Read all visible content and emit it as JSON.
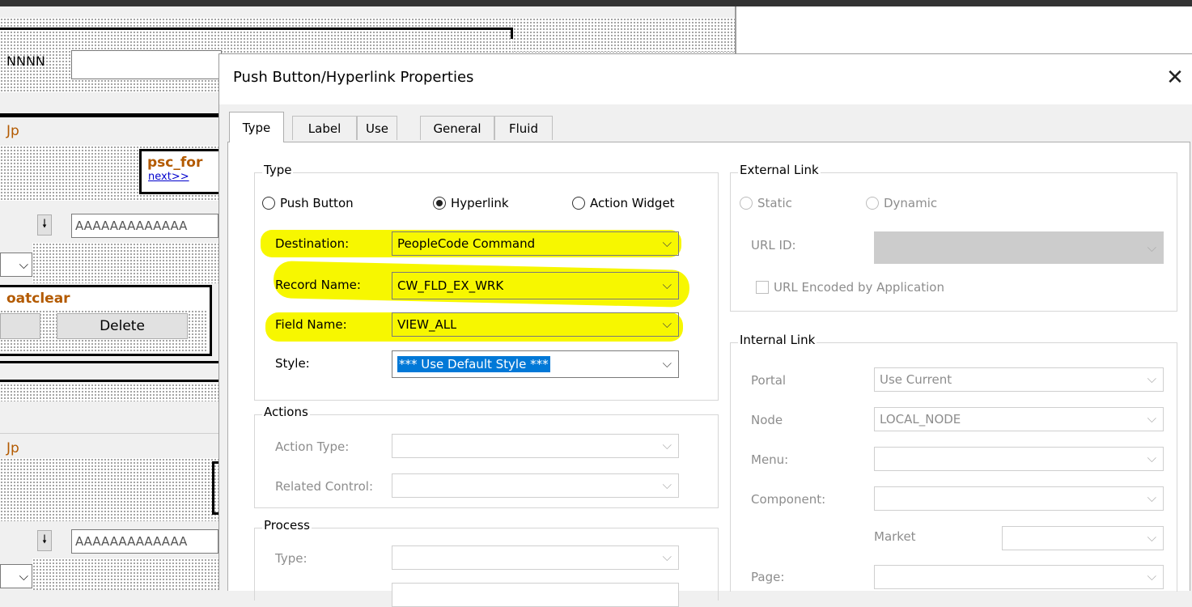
{
  "background": {
    "tab_label_partial": "NNNN",
    "section_label_1": "Jp",
    "section_label_2": "Jp",
    "psc_label": "psc_for",
    "next_link": "next>>",
    "field_placeholder_1": "AAAAAAAAAAAAA",
    "field_placeholder_2": "AAAAAAAAAAAAA",
    "floatclear_label": "oatclear",
    "delete_button": "Delete"
  },
  "dialog": {
    "title": "Push Button/Hyperlink Properties",
    "close_glyph": "✕",
    "tabs": [
      {
        "label": "Type",
        "active": true
      },
      {
        "label": "Label",
        "active": false
      },
      {
        "label": "Use",
        "active": false
      },
      {
        "label": "General",
        "active": false
      },
      {
        "label": "Fluid",
        "active": false
      }
    ],
    "type_group": {
      "title": "Type",
      "radios": [
        {
          "label": "Push Button",
          "checked": false
        },
        {
          "label": "Hyperlink",
          "checked": true
        },
        {
          "label": "Action Widget",
          "checked": false
        }
      ],
      "destination_label": "Destination:",
      "destination_value": "PeopleCode Command",
      "record_label": "Record Name:",
      "record_value": "CW_FLD_EX_WRK",
      "field_label": "Field Name:",
      "field_value": "VIEW_ALL",
      "style_label": "Style:",
      "style_value": "*** Use Default Style ***"
    },
    "actions_group": {
      "title": "Actions",
      "action_type_label": "Action Type:",
      "related_control_label": "Related Control:"
    },
    "process_group": {
      "title": "Process",
      "type_label": "Type:"
    },
    "external_link": {
      "title": "External Link",
      "static_label": "Static",
      "dynamic_label": "Dynamic",
      "url_id_label": "URL ID:",
      "url_encoded_label": "URL Encoded by Application"
    },
    "internal_link": {
      "title": "Internal Link",
      "portal_label": "Portal",
      "portal_value": "Use Current",
      "node_label": "Node",
      "node_value": "LOCAL_NODE",
      "menu_label": "Menu:",
      "component_label": "Component:",
      "market_label": "Market",
      "page_label": "Page:"
    }
  },
  "colors": {
    "highlight": "#f7f700",
    "selection": "#0078d7",
    "orange_text": "#b35a00"
  }
}
